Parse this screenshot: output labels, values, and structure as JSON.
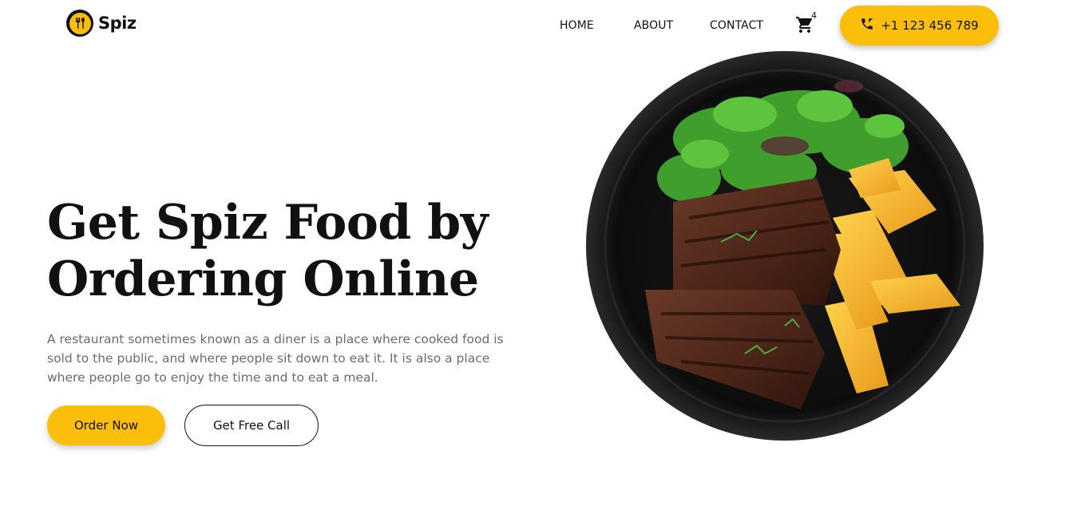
{
  "brand": {
    "name": "Spiz",
    "accent": "#fbbf0b"
  },
  "nav": {
    "items": [
      {
        "label": "HOME"
      },
      {
        "label": "ABOUT"
      },
      {
        "label": "CONTACT"
      }
    ],
    "cart": {
      "icon": "cart-icon",
      "count": "4"
    },
    "phone": {
      "icon": "phone-icon",
      "label": "+1 123 456 789"
    }
  },
  "hero": {
    "title_line1": "Get Spiz Food by",
    "title_line2": "Ordering Online",
    "description": "A restaurant sometimes known as a diner is a place where cooked food is sold to the public, and where people sit down to eat it. It is also a place where people go to enjoy the time and to eat a meal.",
    "primary_button": "Order Now",
    "secondary_button": "Get Free Call",
    "image": "steak-plate-with-salad-and-potatoes"
  }
}
